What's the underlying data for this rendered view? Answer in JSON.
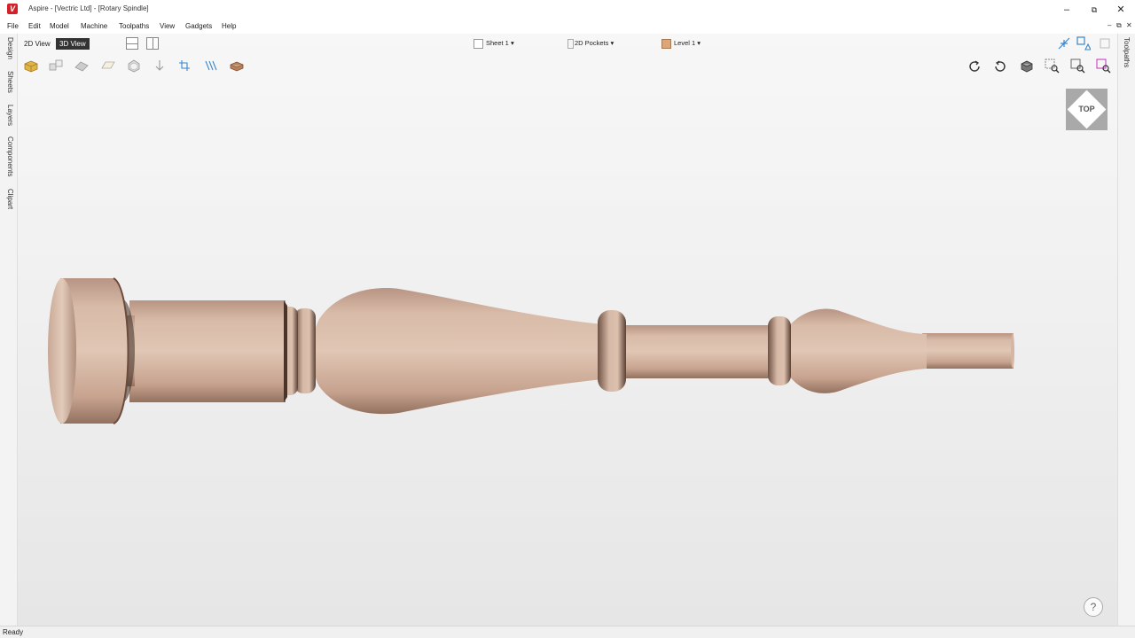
{
  "window": {
    "title": "Aspire - [Vectric Ltd] - [Rotary Spindle]",
    "logo_letter": "V",
    "minimize": "–",
    "maximize": "⧉",
    "close": "✕",
    "mdi_minimize": "–",
    "mdi_restore": "⧉",
    "mdi_close": "✕"
  },
  "menu": [
    "File",
    "Edit",
    "Model",
    "Machine",
    "Toolpaths",
    "View",
    "Gadgets",
    "Help"
  ],
  "left_tabs": [
    "Design",
    "Sheets",
    "Layers",
    "Components",
    "Clipart"
  ],
  "right_tabs": [
    "Toolpaths"
  ],
  "view_tabs": {
    "view_2d": "2D View",
    "view_3d": "3D View",
    "active": "3D View"
  },
  "dropdowns": {
    "sheet": "Sheet 1",
    "pockets": "2D Pockets",
    "level": "Level 1"
  },
  "left_tools": [
    "box-icon",
    "components-icon",
    "texture-icon",
    "plane-icon",
    "gem-icon",
    "arrow-down-icon",
    "crop-icon",
    "lines-icon",
    "material-icon"
  ],
  "right_tools": [
    "rotate-cw-icon",
    "rotate-ccw-icon",
    "cube-view-icon",
    "zoom-box-icon",
    "zoom-fit-icon",
    "zoom-selected-icon"
  ],
  "nav_cube": {
    "label": "TOP"
  },
  "help": {
    "label": "?"
  },
  "status": {
    "text": "Ready"
  },
  "colors": {
    "wood": "#d6b6a2",
    "wood_dark": "#9a7868",
    "accent_red": "#d62027",
    "tab_active": "#333333"
  }
}
